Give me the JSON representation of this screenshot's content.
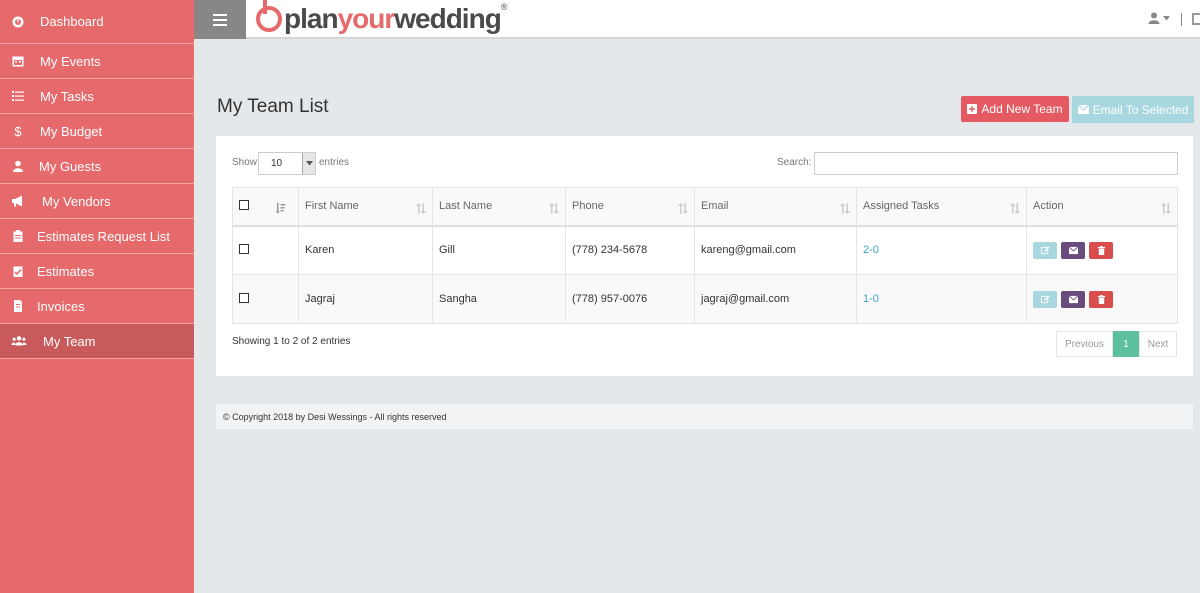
{
  "sidebar": {
    "items": [
      {
        "label": "Dashboard",
        "icon": "dashboard-icon"
      },
      {
        "label": "My Events",
        "icon": "calendar-icon"
      },
      {
        "label": "My Tasks",
        "icon": "tasks-icon"
      },
      {
        "label": "My Budget",
        "icon": "dollar-icon"
      },
      {
        "label": "My Guests",
        "icon": "guest-icon"
      },
      {
        "label": "My Vendors",
        "icon": "megaphone-icon"
      },
      {
        "label": "Estimates Request List",
        "icon": "clipboard-icon"
      },
      {
        "label": "Estimates",
        "icon": "clipboard-check-icon"
      },
      {
        "label": "Invoices",
        "icon": "invoice-icon"
      },
      {
        "label": "My Team",
        "icon": "team-icon"
      }
    ],
    "active_index": 9
  },
  "header": {
    "logo": {
      "part1": "plan",
      "part2": "your",
      "part3": "wedding",
      "reg": "®"
    }
  },
  "main": {
    "title": "My Team List",
    "add_button": "Add New Team",
    "email_selected_button": "Email To Selected"
  },
  "table_controls": {
    "show_label": "Show",
    "entries_value": "10",
    "entries_label": "entries",
    "search_label": "Search:"
  },
  "table": {
    "columns": [
      "First Name",
      "Last Name",
      "Phone",
      "Email",
      "Assigned Tasks",
      "Action"
    ],
    "rows": [
      {
        "first": "Karen",
        "last": "Gill",
        "phone": "(778) 234-5678",
        "email": "kareng@gmail.com",
        "tasks": "2-0"
      },
      {
        "first": "Jagraj",
        "last": "Sangha",
        "phone": "(778) 957-0076",
        "email": "jagraj@gmail.com",
        "tasks": "1-0"
      }
    ]
  },
  "pagination": {
    "info": "Showing 1 to 2 of 2 entries",
    "previous": "Previous",
    "current": "1",
    "next": "Next"
  },
  "footer": {
    "text": "© Copyright 2018 by Desi Wessings - All rights reserved"
  },
  "colors": {
    "sidebar": "#e66a6c",
    "active": "#c85a5c",
    "add_button": "#e55a62",
    "email_button": "#a9d7e0",
    "page_active": "#5cc09f"
  }
}
